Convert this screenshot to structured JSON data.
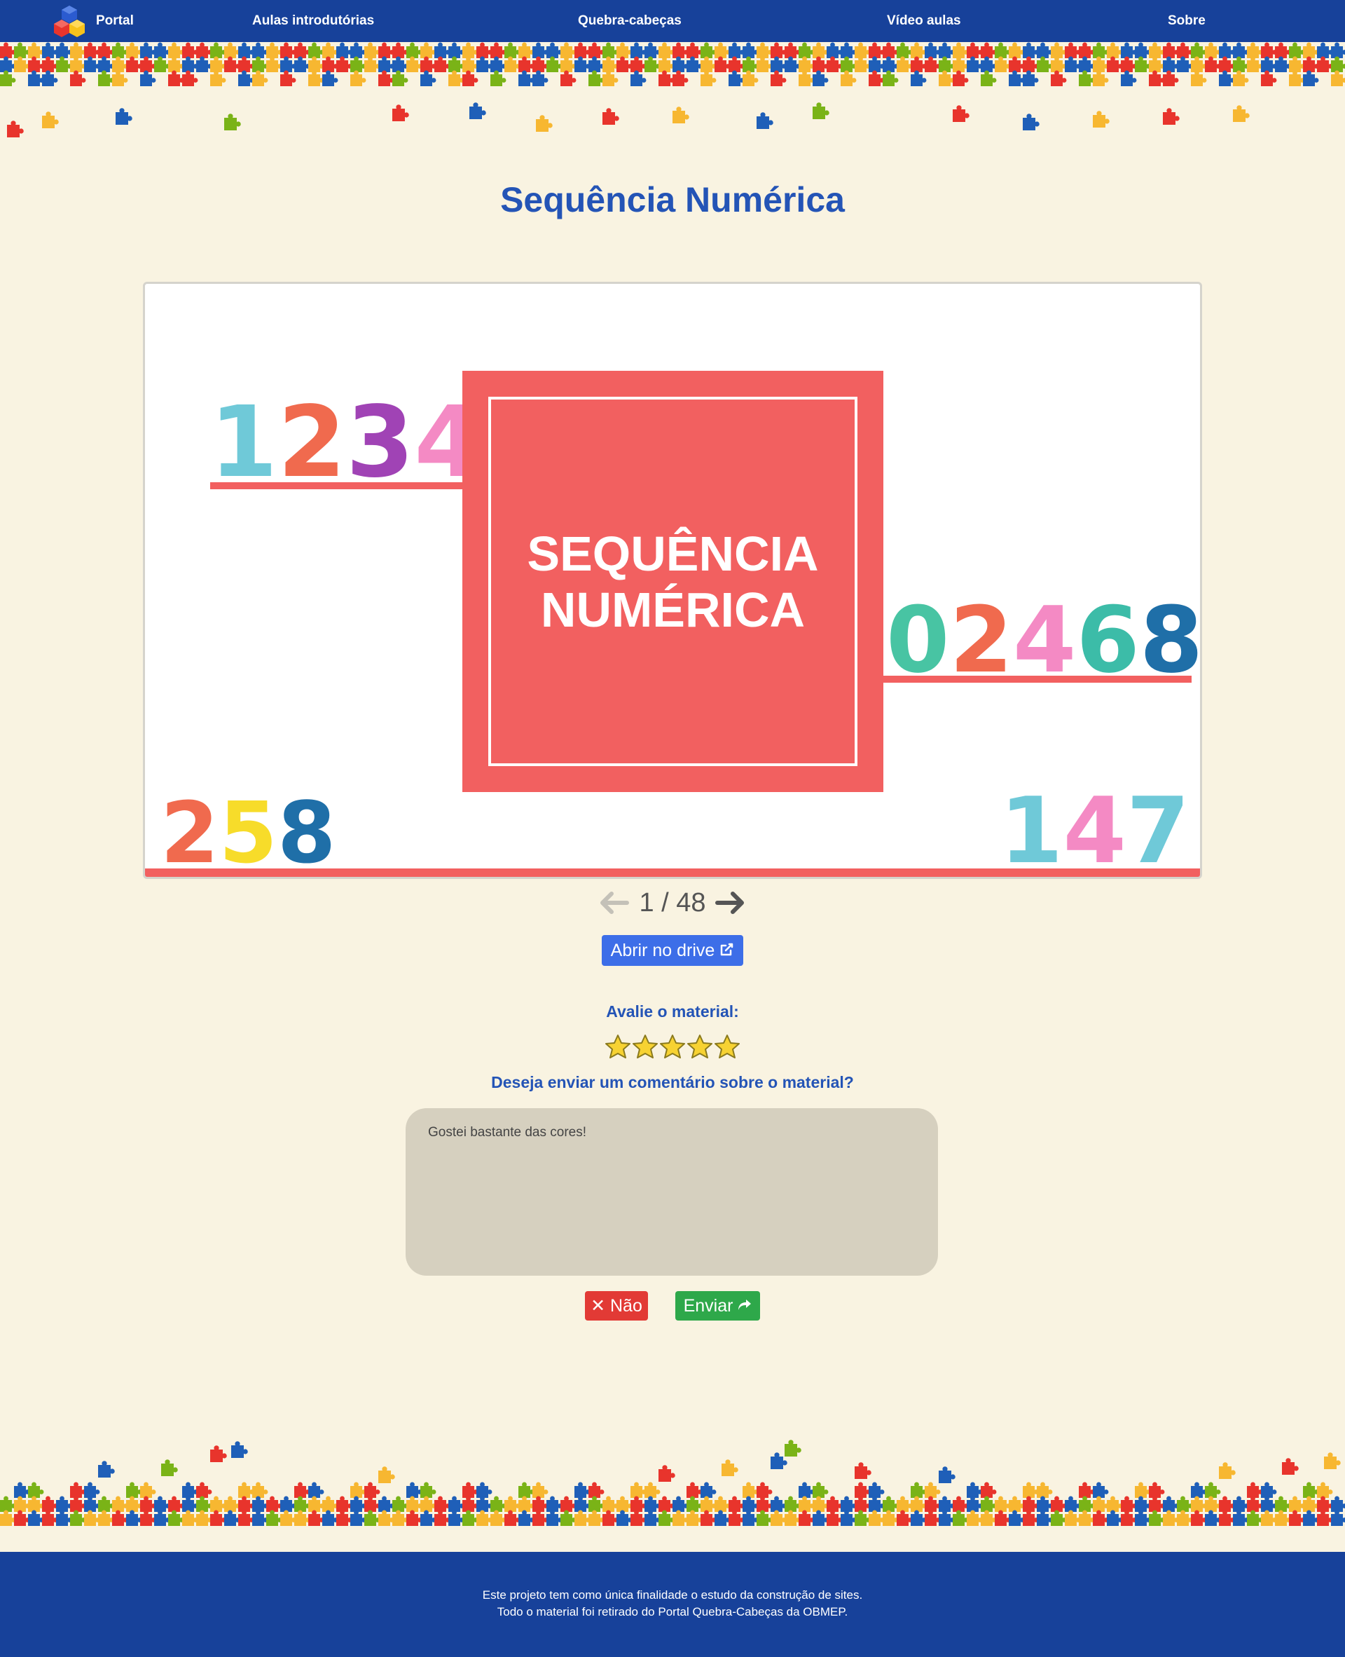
{
  "nav": {
    "brand": "Portal",
    "items": [
      "Aulas introdutórias",
      "Quebra-cabeças",
      "Vídeo aulas",
      "Sobre"
    ]
  },
  "page": {
    "title": "Sequência Numérica"
  },
  "slide": {
    "title": "SEQUÊNCIA NUMÉRICA",
    "number_groups": [
      "1234",
      "02468",
      "258",
      "147"
    ]
  },
  "pager": {
    "text": "1 / 48",
    "current": 1,
    "total": 48
  },
  "drive_button": "Abrir no drive",
  "rating": {
    "label": "Avalie o material:",
    "value": 5,
    "max": 5
  },
  "comment": {
    "label": "Deseja enviar um comentário sobre o material?",
    "value": "Gostei bastante das cores!"
  },
  "buttons": {
    "no": "✕ Não",
    "send": "Enviar"
  },
  "footer": {
    "line1": "Este projeto tem como única finalidade o estudo da construção de sites.",
    "line2": "Todo o material foi retirado do Portal Quebra-Cabeças da OBMEP."
  },
  "colors": {
    "nav": "#17419a",
    "background": "#f9f3e1",
    "title": "#2454b6",
    "slide_accent": "#f26060",
    "drive_button": "#3d6ee8",
    "no_button": "#e23a35",
    "send_button": "#2ea84a"
  },
  "icons": [
    "logo-cubes-icon",
    "arrow-left-icon",
    "arrow-right-icon",
    "external-link-icon",
    "star-icon",
    "reply-icon"
  ]
}
